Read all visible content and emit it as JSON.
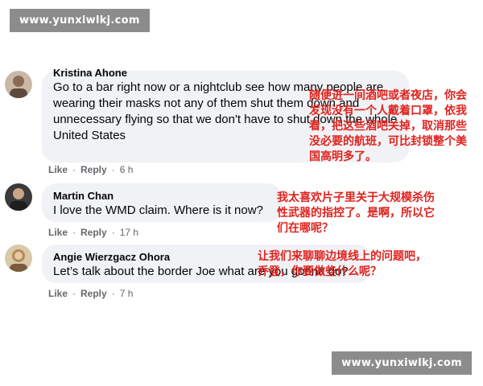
{
  "watermark": "www.yunxiwlkj.com",
  "comments": [
    {
      "author": "Kristina Ahone",
      "text": "Go to a bar right now or a nightclub see how many people are wearing their masks not any of them shut them down and unnecessary flying so that we don't have to shut down the whole United States",
      "like": "Like",
      "reply": "Reply",
      "time": "6 h"
    },
    {
      "author": "Martin Chan",
      "text": "I love the WMD claim. Where is it now?",
      "like": "Like",
      "reply": "Reply",
      "time": "17 h"
    },
    {
      "author": "Angie Wierzgacz Ohora",
      "text": "Let’s talk about the border Joe what are you gonna do?",
      "like": "Like",
      "reply": "Reply",
      "time": "7 h"
    }
  ],
  "annotations": [
    "随便进一间酒吧或者夜店，你会发现没有一个人戴着口罩，依我看，把这些酒吧关掉，取消那些没必要的航班，可比封锁整个美国高明多了。",
    "我太喜欢片子里关于大规模杀伤性武器的指控了。是啊，所以它们在哪呢？",
    "让我们来聊聊边境线上的问题吧，乔登，你要做些什么呢？"
  ]
}
